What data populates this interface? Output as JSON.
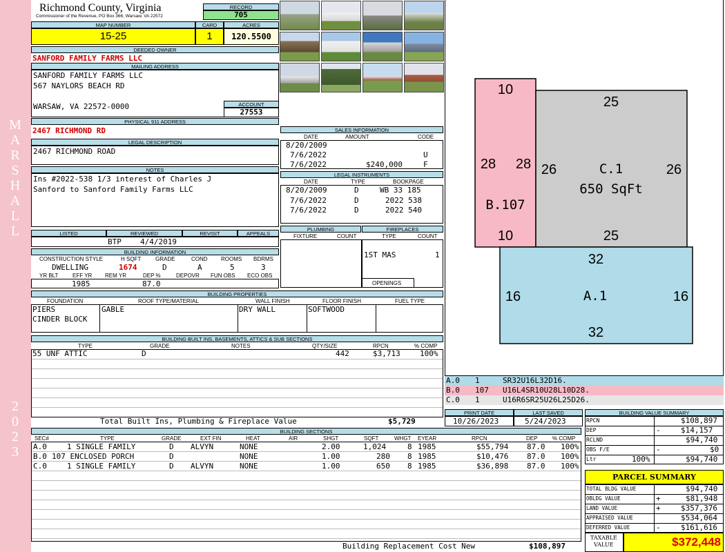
{
  "side": {
    "district": "MARSHALL",
    "year": "2023"
  },
  "header": {
    "county": "Richmond County, Virginia",
    "address": "Commissioner of the Revenue, PO Box 366, Warsaw, VA 22572",
    "record_label": "RECORD",
    "record": "705"
  },
  "map": {
    "map_label": "MAP NUMBER",
    "card_label": "CARD",
    "acres_label": "ACRES",
    "map_number": "15-25",
    "card": "1",
    "acres": "120.5500"
  },
  "owner": {
    "label": "DEEDED OWNER",
    "name": "SANFORD FAMILY FARMS LLC",
    "mail_label": "MAILING ADDRESS",
    "mail1": "SANFORD FAMILY FARMS  LLC",
    "mail2": "567 NAYLORS BEACH RD",
    "mail3": "WARSAW, VA 22572-0000",
    "account_label": "ACCOUNT",
    "account": "27553"
  },
  "address": {
    "label": "PHYSICAL 911 ADDRESS",
    "value": "2467 RICHMOND RD"
  },
  "legal": {
    "label": "LEGAL DESCRIPTION",
    "value": "2467 RICHMOND ROAD"
  },
  "notes": {
    "label": "NOTES",
    "line1": "Ins #2022-538 1/3 interest of Charles J",
    "line2": "Sanford to Sanford Family Farms LLC"
  },
  "review": {
    "h1": "LISTED",
    "h2": "REVIEWED",
    "h3": "REVISIT",
    "h4": "APPEALS",
    "by": "BTP",
    "date": "4/4/2019"
  },
  "building_info": {
    "label": "BUILDING INFORMATION",
    "h1": "CONSTRUCTION STYLE",
    "h2": "H SQFT",
    "h3": "GRADE",
    "h4": "COND",
    "h5": "ROOMS",
    "h6": "BDRMS",
    "style": "DWELLING",
    "hsqft": "1674",
    "grade": "D",
    "cond": "A",
    "rooms": "5",
    "bdrms": "3",
    "h7": "YR BLT",
    "h8": "EFF YR",
    "h9": "REM YR",
    "h10": "DEP %",
    "h11": "DEPOVR",
    "h12": "FUN OBS",
    "h13": "ECO OBS",
    "effyr": "1985",
    "dep": "87.0"
  },
  "sales": {
    "label": "SALES INFORMATION",
    "h1": "DATE",
    "h2": "AMOUNT",
    "h3": "CODE",
    "rows": [
      {
        "date": "8/20/2009",
        "amount": "",
        "code": ""
      },
      {
        "date": "7/6/2022",
        "amount": "",
        "code": "U"
      },
      {
        "date": "7/6/2022",
        "amount": "$240,000",
        "code": "F"
      }
    ]
  },
  "instruments": {
    "label": "LEGAL INSTRUMENTS",
    "h1": "DATE",
    "h2": "TYPE",
    "h3": "BOOKPAGE",
    "rows": [
      {
        "date": "8/20/2009",
        "type": "D",
        "book": "WB 33 185"
      },
      {
        "date": "7/6/2022",
        "type": "D",
        "book": "2022 538"
      },
      {
        "date": "7/6/2022",
        "type": "D",
        "book": "2022 540"
      }
    ]
  },
  "plumbing": {
    "label": "PLUMBING",
    "h1": "FIXTURE",
    "h2": "COUNT",
    "fp_label": "FIREPLACES",
    "h3": "TYPE",
    "h4": "COUNT",
    "fp_type": "1ST MAS",
    "fp_count": "1",
    "openings": "OPENINGS"
  },
  "properties": {
    "label": "BUILDING PROPERTIES",
    "h1": "FOUNDATION",
    "h2": "ROOF TYPE/MATERIAL",
    "h3": "WALL FINISH",
    "h4": "FLOOR FINISH",
    "h5": "FUEL TYPE",
    "found1": "PIERS",
    "found2": "CINDER BLOCK",
    "roof": "GABLE",
    "wall": "DRY WALL",
    "floor": "SOFTWOOD"
  },
  "builtins": {
    "label": "BUILDING BUILT INS, BASEMENTS, ATTICS & SUB SECTIONS",
    "h1": "TYPE",
    "h2": "GRADE",
    "h3": "NOTES",
    "h4": "QTY/SIZE",
    "h5": "RPCN",
    "h6": "% COMP",
    "type": "55 UNF ATTIC",
    "grade": "D",
    "qty": "442",
    "rpcn": "$3,713",
    "comp": "100%",
    "total_label": "Total Built Ins, Plumbing & Fireplace Value",
    "total": "$5,729"
  },
  "sections": {
    "label": "BUILDING SECTIONS",
    "h1": "SEC#",
    "h2": "TYPE",
    "h3": "GRADE",
    "h4": "EXT FIN",
    "h5": "HEAT",
    "h6": "AIR",
    "h7": "SHGT",
    "h8": "SQFT",
    "h9": "WHGT",
    "h10": "EYEAR",
    "h11": "RPCN",
    "h12": "DEP",
    "h13": "% COMP",
    "rows": [
      {
        "sec": "A.0",
        "type": "1 SINGLE FAMILY",
        "grade": "D",
        "ext": "ALVYN",
        "heat": "NONE",
        "shgt": "2.00",
        "sqft": "1,024",
        "whgt": "8",
        "eyear": "1985",
        "rpcn": "$55,794",
        "dep": "87.0",
        "comp": "100%"
      },
      {
        "sec": "B.0",
        "type": "107 ENCLOSED PORCH",
        "grade": "D",
        "ext": "",
        "heat": "NONE",
        "shgt": "1.00",
        "sqft": "280",
        "whgt": "8",
        "eyear": "1985",
        "rpcn": "$10,476",
        "dep": "87.0",
        "comp": "100%"
      },
      {
        "sec": "C.0",
        "type": "1 SINGLE FAMILY",
        "grade": "D",
        "ext": "ALVYN",
        "heat": "NONE",
        "shgt": "1.00",
        "sqft": "650",
        "whgt": "8",
        "eyear": "1985",
        "rpcn": "$36,898",
        "dep": "87.0",
        "comp": "100%"
      }
    ],
    "total_label": "Building Replacement Cost New",
    "total": "$108,897"
  },
  "sketch": {
    "b_top": "10",
    "b_bottom": "10",
    "b_left": "28",
    "b_right": "28",
    "b_label": "B.107",
    "c_top": "25",
    "c_bottom": "25",
    "c_left": "26",
    "c_right": "26",
    "c_label": "C.1",
    "c_area": "650 SqFt",
    "a_top": "32",
    "a_bottom": "32",
    "a_left": "16",
    "a_right": "16",
    "a_label": "A.1",
    "colors": {
      "b": "#f7b9c6",
      "c": "#cccccc",
      "a": "#b0dbe8"
    }
  },
  "vectors": [
    {
      "code": "A.0",
      "n": "1",
      "path": "SR32U16L32D16."
    },
    {
      "code": "B.0",
      "n": "107",
      "path": "U16L4SR10U28L10D28."
    },
    {
      "code": "C.0",
      "n": "1",
      "path": "U16R6SR25U26L25D26."
    }
  ],
  "print": {
    "h1": "PRINT DATE",
    "h2": "LAST SAVED",
    "print_date": "10/26/2023",
    "saved": "5/24/2023"
  },
  "bvs": {
    "label": "BUILDING VALUE SUMMARY",
    "rpcn_l": "RPCN",
    "rpcn": "$108,897",
    "dep_l": "DEP",
    "dep_s": "-",
    "dep": "$14,157",
    "rclnd_l": "RCLND",
    "rclnd": "$94,740",
    "obs_l": "OBS F/E",
    "obs_s": "-",
    "obs": "$0",
    "ltr_l": "Ltr",
    "ltr_p": "100%",
    "ltr": "$94,740"
  },
  "parcel": {
    "label": "PARCEL SUMMARY",
    "bldg_l": "TOTAL BLDG VALUE",
    "bldg": "$94,740",
    "obldg_l": "OBLDG VALUE",
    "obldg_s": "+",
    "obldg": "$81,948",
    "land_l": "LAND VALUE",
    "land_s": "+",
    "land": "$357,376",
    "appr_l": "APPRAISED VALUE",
    "appr": "$534,064",
    "def_l": "DEFERRED VALUE",
    "def_s": "-",
    "def": "$161,616",
    "tax_l1": "TAXABLE",
    "tax_l2": "VALUE",
    "tax": "$372,448"
  }
}
